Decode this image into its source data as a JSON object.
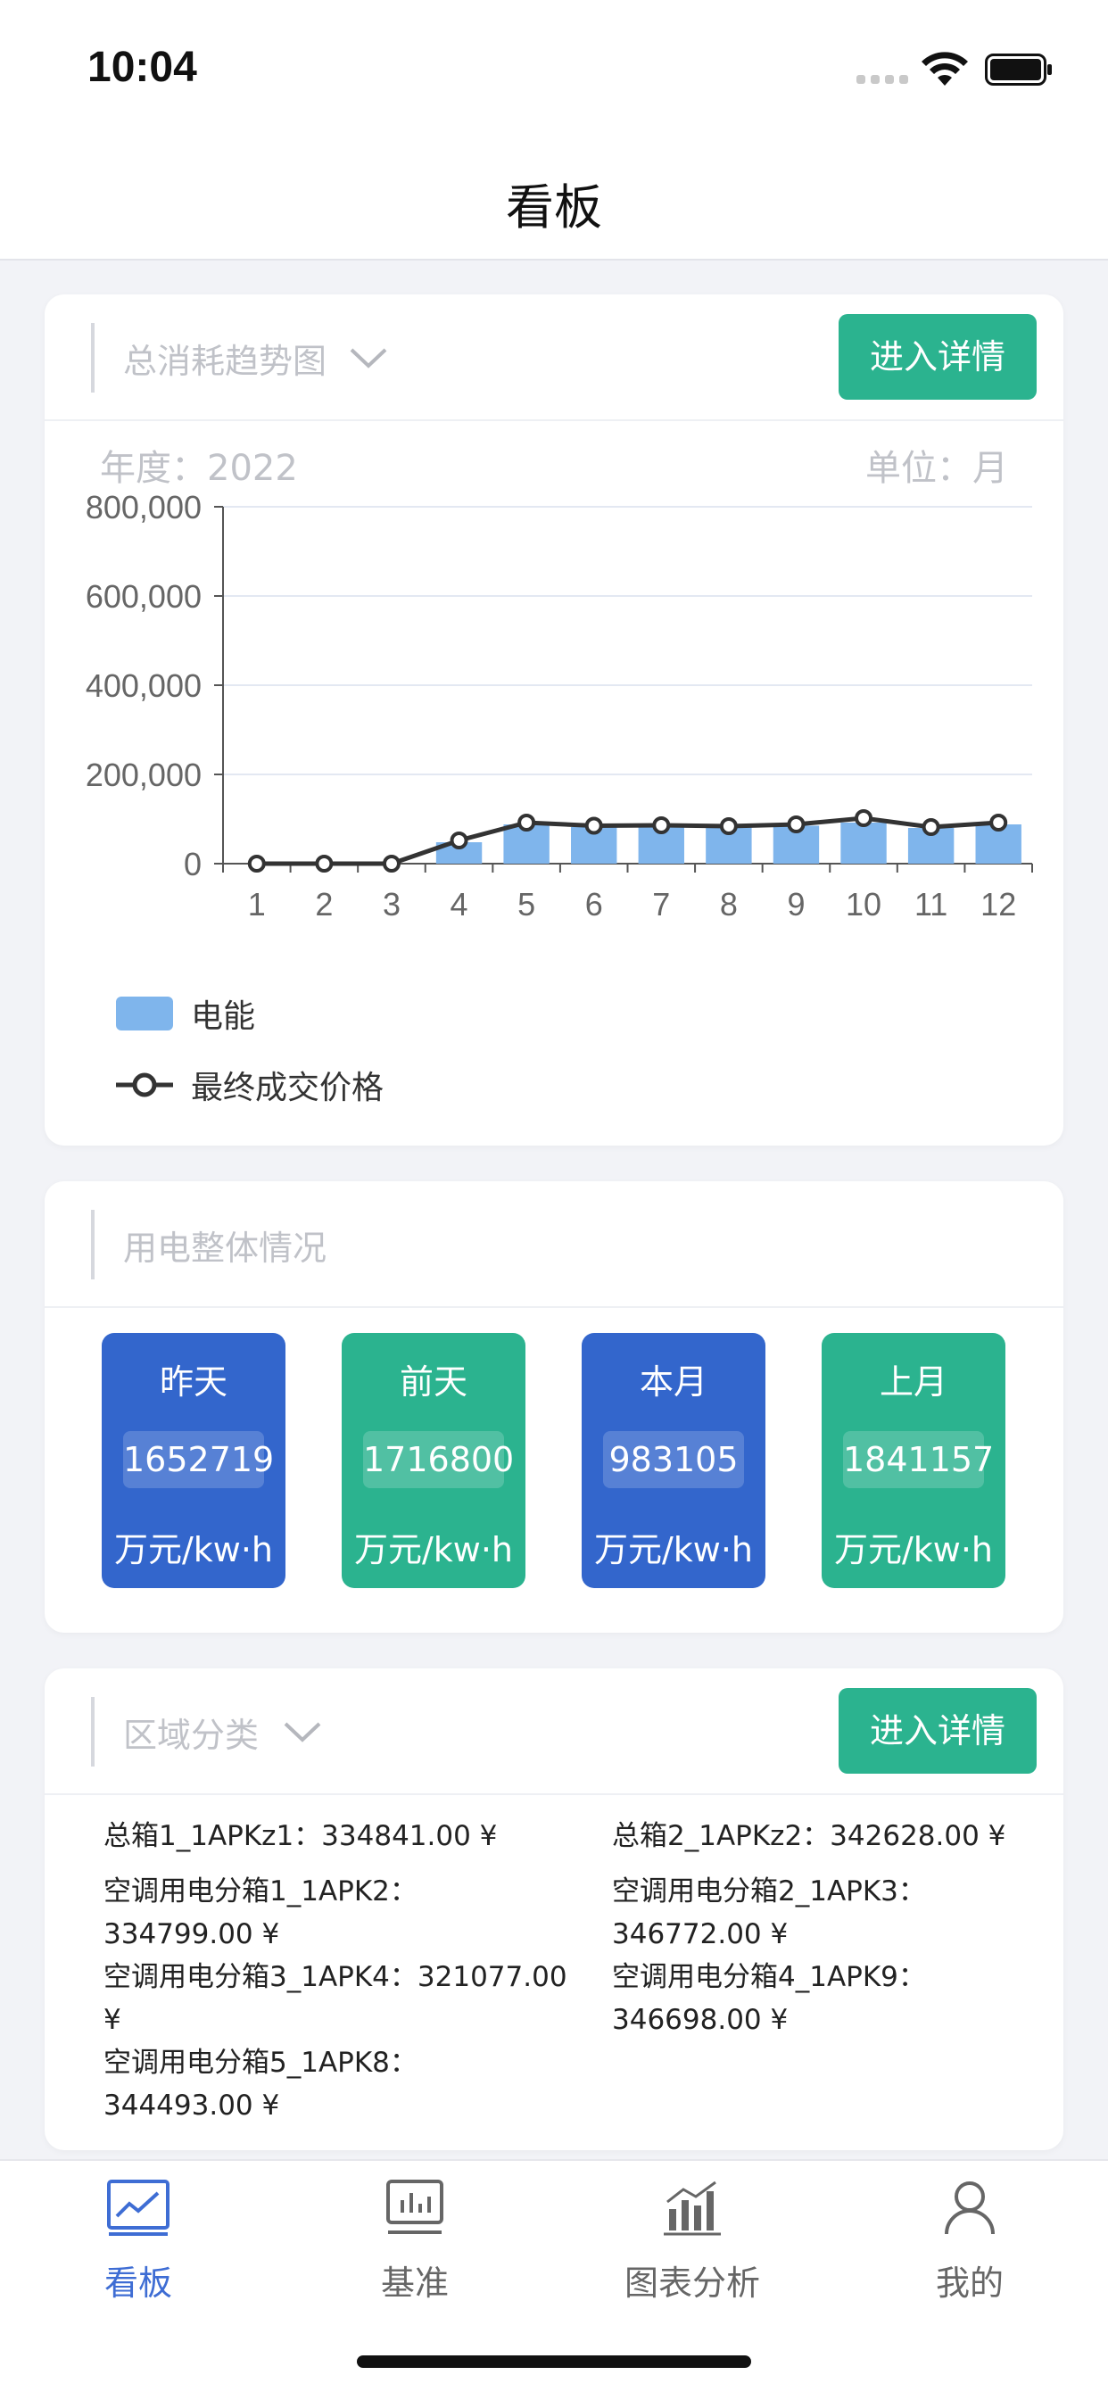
{
  "status_bar": {
    "time": "10:04"
  },
  "nav": {
    "title": "看板"
  },
  "trend_card": {
    "header_label": "总消耗趋势图",
    "detail_button": "进入详情",
    "year_label": "年度：",
    "year_value": "2022",
    "unit_label": "单位：",
    "unit_value": "月"
  },
  "chart_data": {
    "type": "bar",
    "categories": [
      "1",
      "2",
      "3",
      "4",
      "5",
      "6",
      "7",
      "8",
      "9",
      "10",
      "11",
      "12"
    ],
    "series": [
      {
        "name": "电能",
        "type": "bar",
        "values": [
          0,
          0,
          0,
          48000,
          88000,
          82000,
          82000,
          82000,
          85000,
          92000,
          80000,
          88000
        ]
      },
      {
        "name": "最终成交价格",
        "type": "line",
        "values": [
          0,
          0,
          0,
          52000,
          92000,
          85000,
          86000,
          84000,
          88000,
          102000,
          82000,
          92000
        ]
      }
    ],
    "yticks": [
      "0",
      "200,000",
      "400,000",
      "600,000",
      "800,000"
    ],
    "ylim": [
      0,
      800000
    ],
    "grid": true,
    "legend_position": "bottom-left",
    "colors": {
      "bar": "#7fb5ec",
      "line": "#333333"
    }
  },
  "usage_card": {
    "header_label": "用电整体情况",
    "stats": [
      {
        "title": "昨天",
        "value": "1652719",
        "unit": "万元/kw·h",
        "color": "#3366cc"
      },
      {
        "title": "前天",
        "value": "1716800",
        "unit": "万元/kw·h",
        "color": "#2bb38f"
      },
      {
        "title": "本月",
        "value": "983105",
        "unit": "万元/kw·h",
        "color": "#3366cc"
      },
      {
        "title": "上月",
        "value": "1841157",
        "unit": "万元/kw·h",
        "color": "#2bb38f"
      }
    ]
  },
  "region_card": {
    "header_label": "区域分类",
    "detail_button": "进入详情",
    "items": [
      {
        "line1": "总箱1_1APKz1：334841.00 ¥",
        "line2": ""
      },
      {
        "line1": "总箱2_1APKz2：342628.00 ¥",
        "line2": ""
      },
      {
        "line1": "空调用电分箱1_1APK2：",
        "line2": "334799.00 ¥"
      },
      {
        "line1": "空调用电分箱2_1APK3：",
        "line2": "346772.00 ¥"
      },
      {
        "line1": "空调用电分箱3_1APK4：321077.00",
        "line2": "¥"
      },
      {
        "line1": "空调用电分箱4_1APK9：",
        "line2": "346698.00 ¥"
      },
      {
        "line1": "空调用电分箱5_1APK8：",
        "line2": "344493.00 ¥"
      }
    ]
  },
  "tabbar": {
    "tabs": [
      {
        "label": "看板",
        "icon": "dashboard-icon",
        "active": true
      },
      {
        "label": "基准",
        "icon": "benchmark-icon",
        "active": false
      },
      {
        "label": "图表分析",
        "icon": "chart-analysis-icon",
        "active": false
      },
      {
        "label": "我的",
        "icon": "profile-icon",
        "active": false
      }
    ]
  },
  "colors": {
    "accent": "#2bb38f",
    "primary_blue": "#3366cc",
    "active_tab": "#3e6dd4"
  }
}
